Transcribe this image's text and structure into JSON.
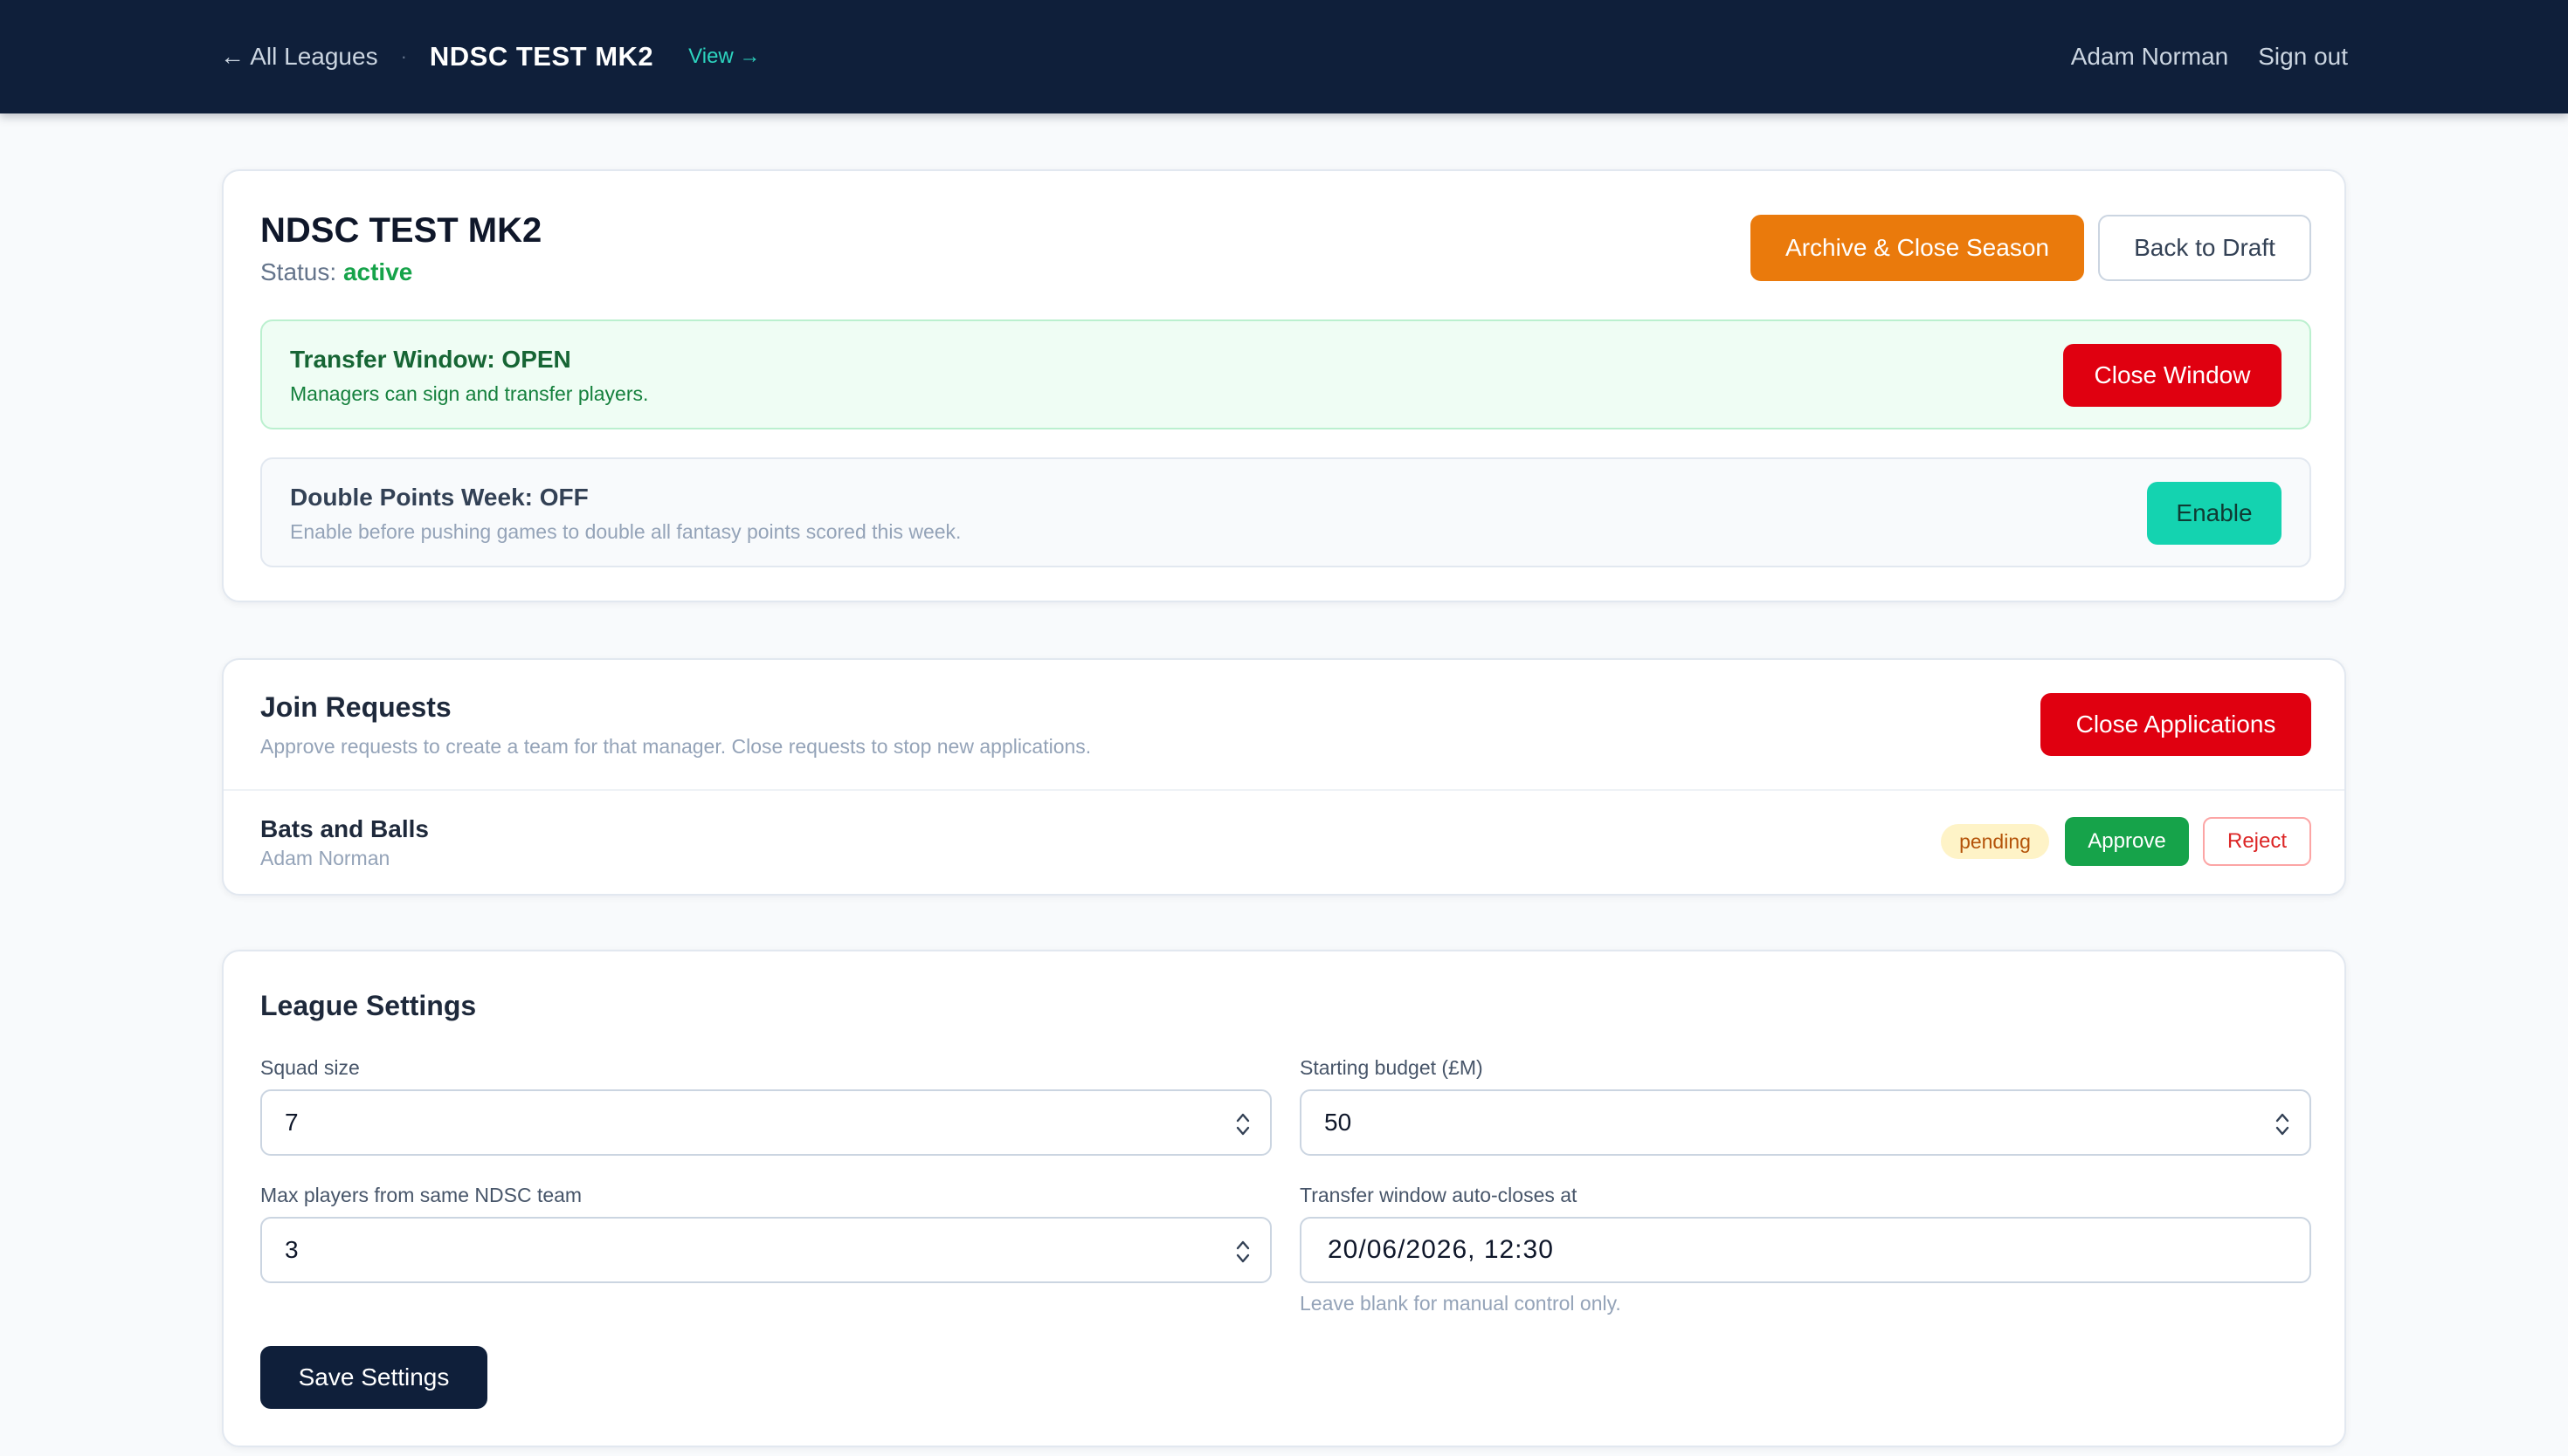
{
  "nav": {
    "back_label": "← All Leagues",
    "separator": "·",
    "league_name": "NDSC TEST MK2",
    "view_label": "View →",
    "user_name": "Adam Norman",
    "signout_label": "Sign out"
  },
  "season": {
    "title": "NDSC TEST MK2",
    "status_label": "Status:",
    "status_value": "active",
    "archive_label": "Archive & Close Season",
    "draft_label": "Back to Draft"
  },
  "transfer_window": {
    "title": "Transfer Window: OPEN",
    "subtitle": "Managers can sign and transfer players.",
    "button_label": "Close Window"
  },
  "double_points": {
    "title": "Double Points Week: OFF",
    "subtitle": "Enable before pushing games to double all fantasy points scored this week.",
    "button_label": "Enable"
  },
  "join_requests": {
    "title": "Join Requests",
    "subtitle": "Approve requests to create a team for that manager. Close requests to stop new applications.",
    "close_label": "Close Applications",
    "items": [
      {
        "team": "Bats and Balls",
        "manager": "Adam Norman",
        "status": "pending",
        "approve_label": "Approve",
        "reject_label": "Reject"
      }
    ]
  },
  "settings": {
    "title": "League Settings",
    "squad_size_label": "Squad size",
    "squad_size_value": "7",
    "budget_label": "Starting budget (£M)",
    "budget_value": "50",
    "max_players_label": "Max players from same NDSC team",
    "max_players_value": "3",
    "auto_close_label": "Transfer window auto-closes at",
    "auto_close_value": "20/06/2026, 12:30",
    "auto_close_hint": "Leave blank for manual control only.",
    "save_label": "Save Settings"
  },
  "colors": {
    "nav_bg": "#0f1f3a",
    "accent_teal": "#14d3b0",
    "danger": "#e00010",
    "warning": "#ea7a0c",
    "success": "#16a34a"
  }
}
